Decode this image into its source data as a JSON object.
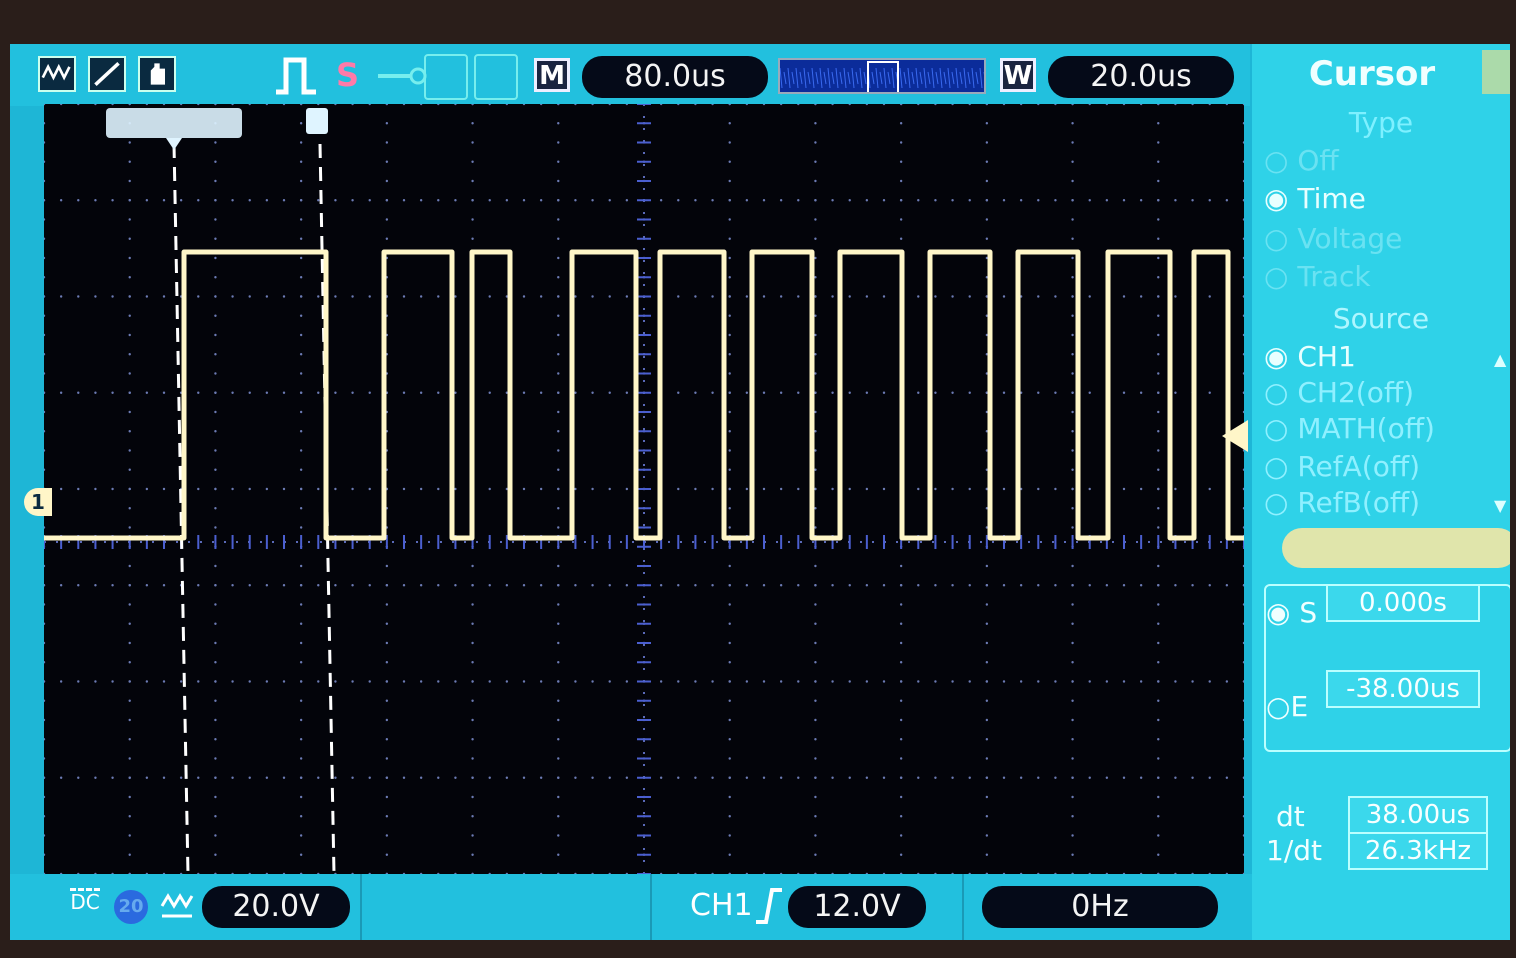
{
  "topbar": {
    "mode_tag": "M",
    "timebase": "80.0us",
    "window_tag": "W",
    "window_timebase": "20.0us",
    "icons": [
      "run-mode-icon",
      "slope-icon",
      "hand-icon",
      "pulse-icon",
      "s-icon",
      "key-icon",
      "usb-icon",
      "printer-icon"
    ]
  },
  "menu": {
    "title": "Cursor",
    "type_header": "Type",
    "type_options": [
      "Off",
      "Time",
      "Voltage",
      "Track"
    ],
    "type_selected": "Time",
    "source_header": "Source",
    "source_options": [
      "CH1",
      "CH2(off)",
      "MATH(off)",
      "RefA(off)",
      "RefB(off)"
    ],
    "source_selected": "CH1",
    "start_label": "S",
    "start_value": "0.000s",
    "end_label": "E",
    "end_value": "-38.00us",
    "dt_label": "dt",
    "dt_value": "38.00us",
    "inv_dt_label": "1/dt",
    "inv_dt_value": "26.3kHz"
  },
  "bottombar": {
    "coupling": "DC",
    "bw_limit": "20",
    "volts_div": "20.0V",
    "trigger_source": "CH1",
    "trigger_level": "12.0V",
    "frequency": "0Hz"
  },
  "channel_marker": "1",
  "waveform": {
    "color": "#fff6c8",
    "grid_color": "#6c7bb4",
    "cursor_color": "#ffffff"
  }
}
